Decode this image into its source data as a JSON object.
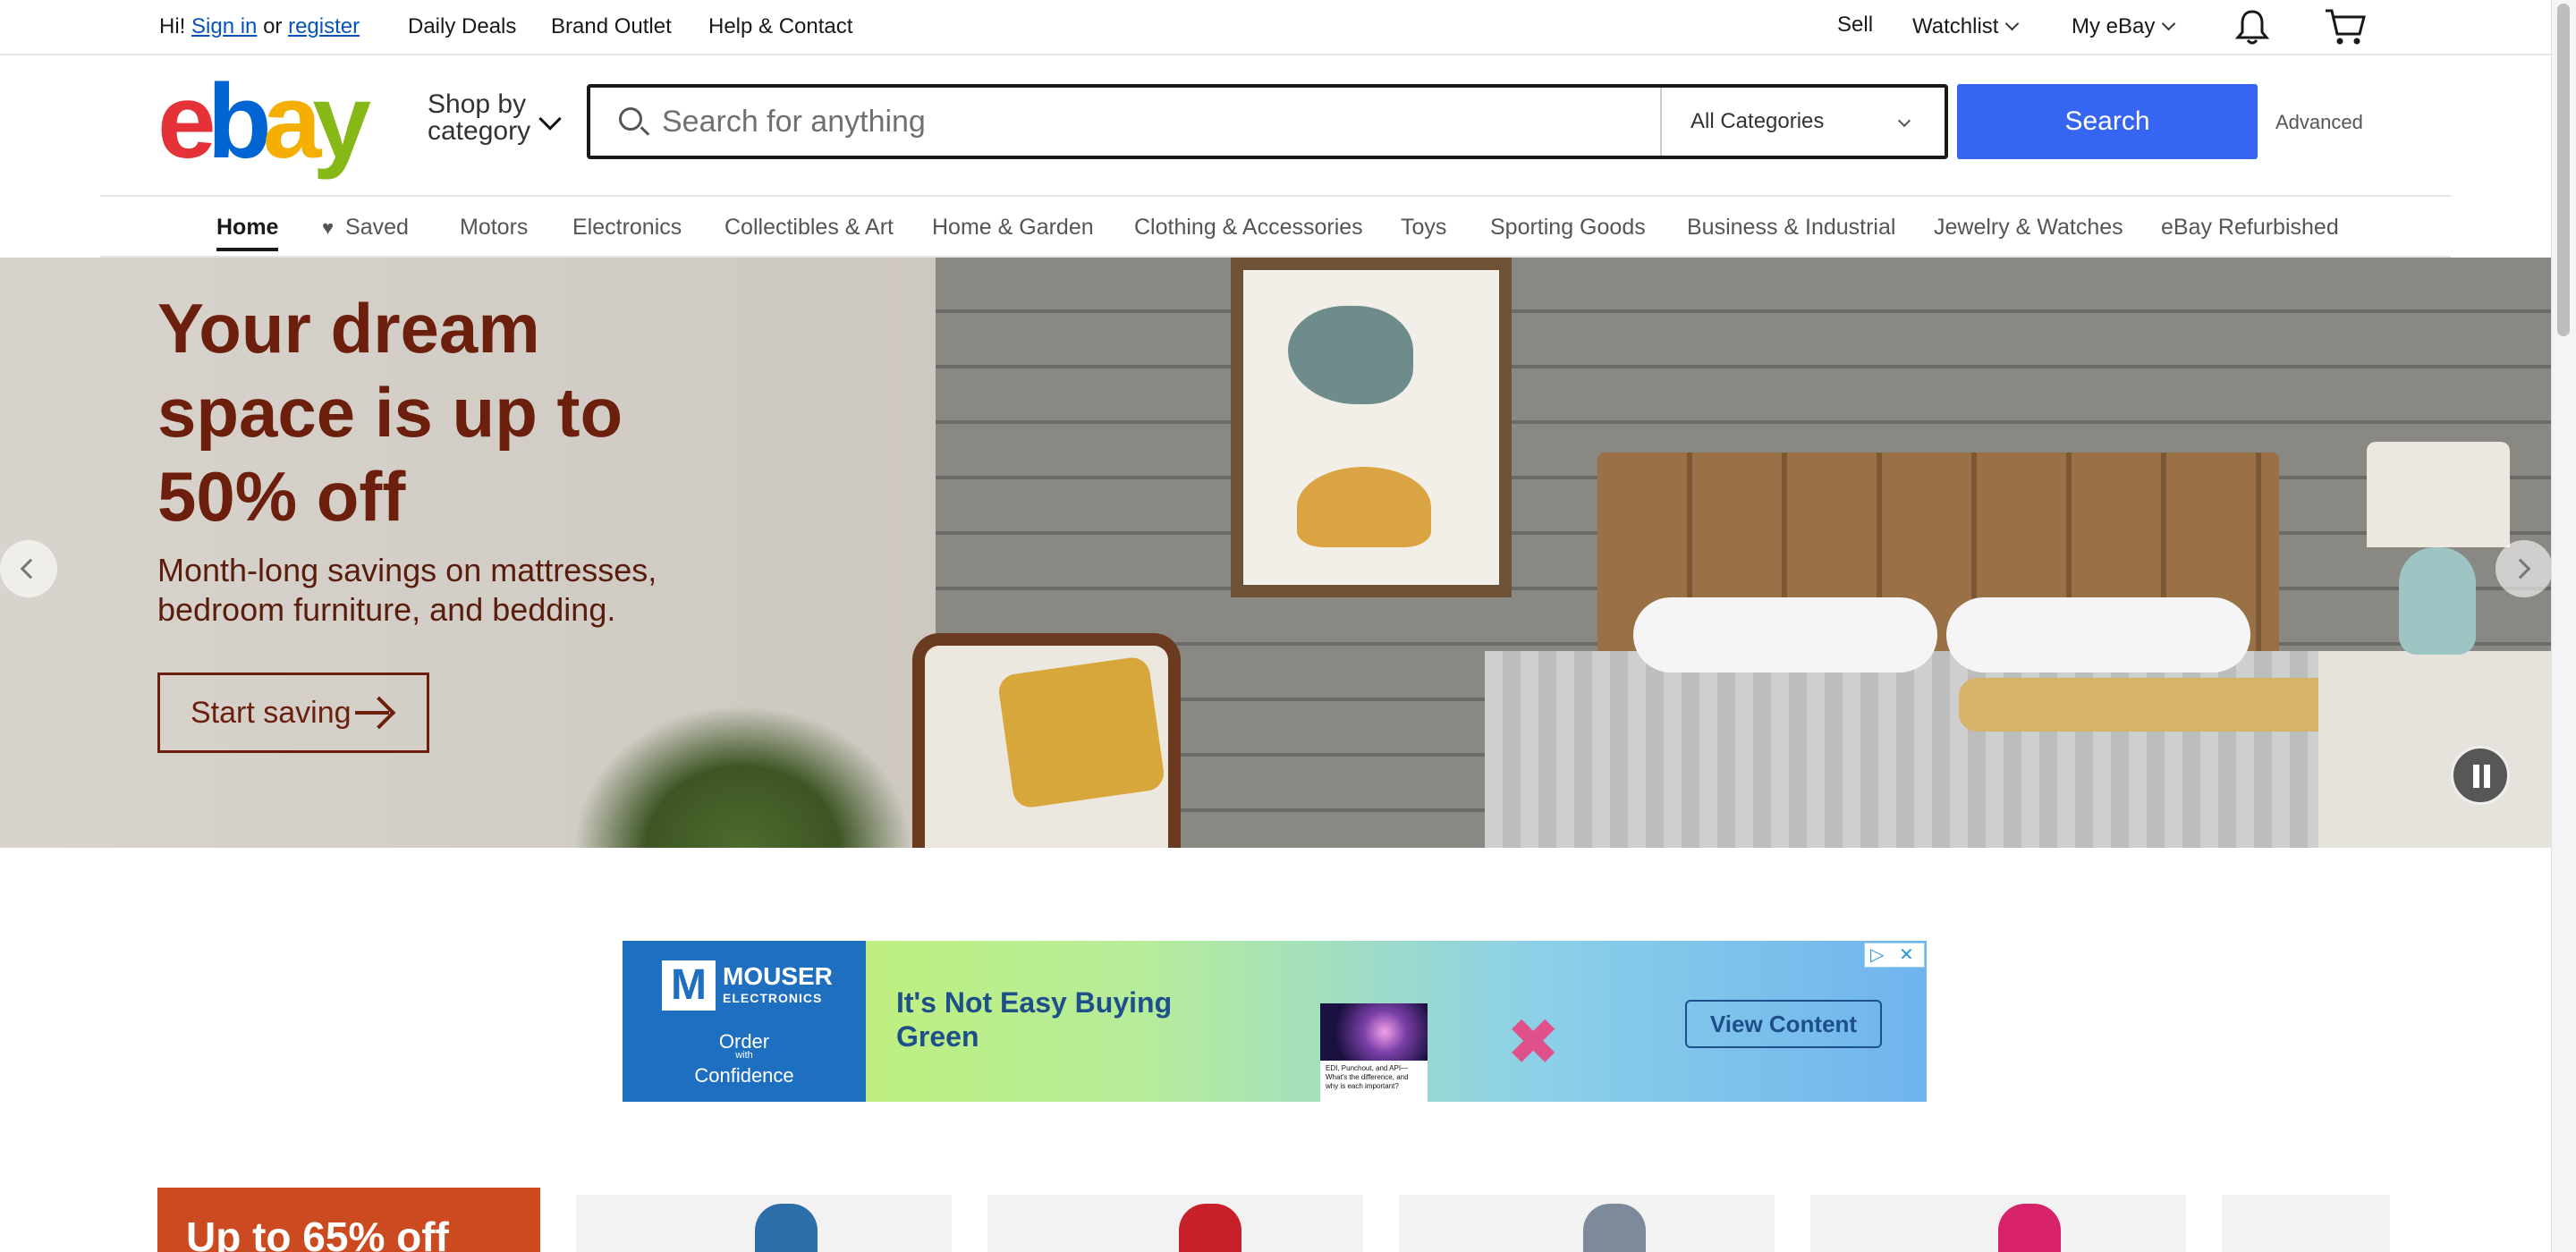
{
  "topbar": {
    "greeting": "Hi!",
    "sign_in": "Sign in",
    "or": "or",
    "register": "register",
    "links": [
      "Daily Deals",
      "Brand Outlet",
      "Help & Contact"
    ],
    "sell": "Sell",
    "watchlist": "Watchlist",
    "my_ebay": "My eBay",
    "notification_icon": "bell-icon",
    "cart_icon": "cart-icon"
  },
  "header": {
    "logo": {
      "e": "e",
      "b": "b",
      "a": "a",
      "y": "y"
    },
    "logo_colors": [
      "#e53238",
      "#0064d2",
      "#f5af02",
      "#86b817"
    ],
    "shop_by_line1": "Shop by",
    "shop_by_line2": "category",
    "search_placeholder": "Search for anything",
    "category_select": "All Categories",
    "search_button": "Search",
    "advanced": "Advanced",
    "accent_color": "#3665f3"
  },
  "nav": {
    "items": [
      "Home",
      "Saved",
      "Motors",
      "Electronics",
      "Collectibles & Art",
      "Home & Garden",
      "Clothing & Accessories",
      "Toys",
      "Sporting Goods",
      "Business & Industrial",
      "Jewelry & Watches",
      "eBay Refurbished"
    ],
    "active": "Home"
  },
  "hero": {
    "title": "Your dream space is up to 50% off",
    "subtitle": "Month-long savings on mattresses, bedroom furniture, and bedding.",
    "cta": "Start saving",
    "text_color": "#6b1f0c"
  },
  "ad": {
    "brand": "MOUSER",
    "brand_sub": "ELECTRONICS",
    "tag_order": "Order",
    "tag_with": "with",
    "tag_confidence": "Confidence",
    "headline": "It's Not Easy Buying Green",
    "thumb_text": "EDI, Punchout, and API—What's the difference, and why is each important?",
    "button": "View Content"
  },
  "promo": {
    "label": "Up to 65% off",
    "color": "#cc4a1f"
  }
}
